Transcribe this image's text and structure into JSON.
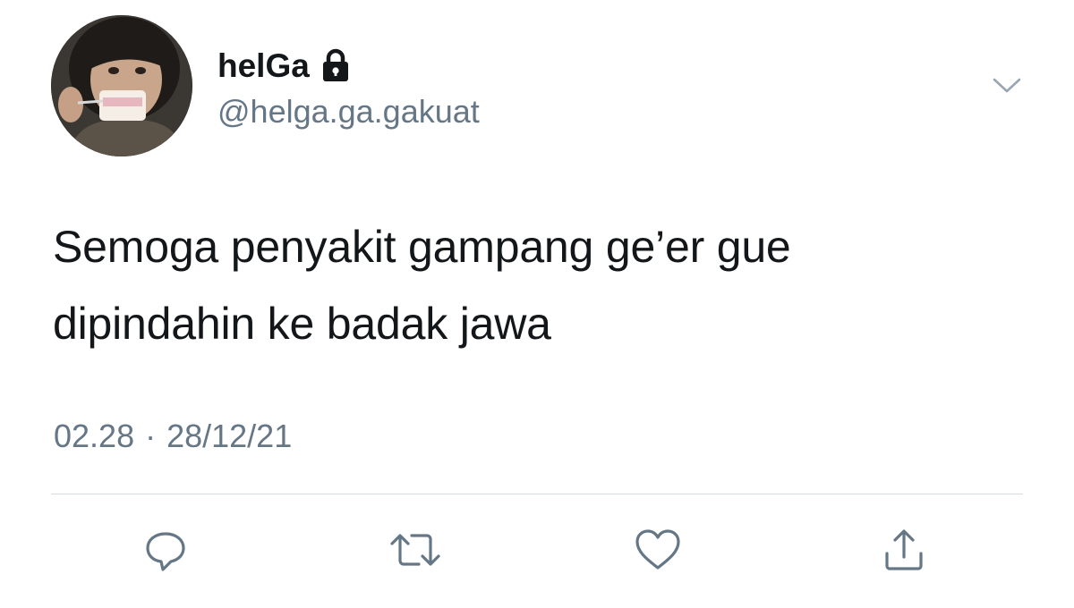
{
  "tweet": {
    "display_name": "helGa",
    "handle": "@helga.ga.gakuat",
    "text_lines": [
      "Semoga penyakit gampang ge’er gue",
      "dipindahin ke badak jawa"
    ],
    "time": "02.28",
    "separator": "·",
    "date": "28/12/21"
  },
  "icons": {
    "protected": "lock-icon",
    "menu": "chevron-down-icon",
    "actions": [
      "reply-icon",
      "retweet-icon",
      "like-icon",
      "share-icon"
    ]
  },
  "colors": {
    "text_primary": "#14171a",
    "text_secondary": "#657786",
    "icon": "#657786",
    "divider": "#d6dbdf",
    "background": "#ffffff"
  }
}
